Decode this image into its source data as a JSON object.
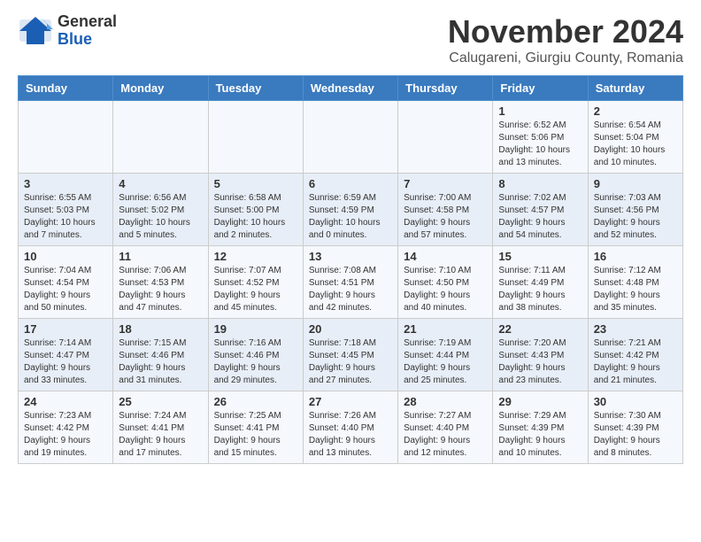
{
  "header": {
    "logo_line1": "General",
    "logo_line2": "Blue",
    "month": "November 2024",
    "location": "Calugareni, Giurgiu County, Romania"
  },
  "weekdays": [
    "Sunday",
    "Monday",
    "Tuesday",
    "Wednesday",
    "Thursday",
    "Friday",
    "Saturday"
  ],
  "weeks": [
    [
      {
        "day": "",
        "info": ""
      },
      {
        "day": "",
        "info": ""
      },
      {
        "day": "",
        "info": ""
      },
      {
        "day": "",
        "info": ""
      },
      {
        "day": "",
        "info": ""
      },
      {
        "day": "1",
        "info": "Sunrise: 6:52 AM\nSunset: 5:06 PM\nDaylight: 10 hours and 13 minutes."
      },
      {
        "day": "2",
        "info": "Sunrise: 6:54 AM\nSunset: 5:04 PM\nDaylight: 10 hours and 10 minutes."
      }
    ],
    [
      {
        "day": "3",
        "info": "Sunrise: 6:55 AM\nSunset: 5:03 PM\nDaylight: 10 hours and 7 minutes."
      },
      {
        "day": "4",
        "info": "Sunrise: 6:56 AM\nSunset: 5:02 PM\nDaylight: 10 hours and 5 minutes."
      },
      {
        "day": "5",
        "info": "Sunrise: 6:58 AM\nSunset: 5:00 PM\nDaylight: 10 hours and 2 minutes."
      },
      {
        "day": "6",
        "info": "Sunrise: 6:59 AM\nSunset: 4:59 PM\nDaylight: 10 hours and 0 minutes."
      },
      {
        "day": "7",
        "info": "Sunrise: 7:00 AM\nSunset: 4:58 PM\nDaylight: 9 hours and 57 minutes."
      },
      {
        "day": "8",
        "info": "Sunrise: 7:02 AM\nSunset: 4:57 PM\nDaylight: 9 hours and 54 minutes."
      },
      {
        "day": "9",
        "info": "Sunrise: 7:03 AM\nSunset: 4:56 PM\nDaylight: 9 hours and 52 minutes."
      }
    ],
    [
      {
        "day": "10",
        "info": "Sunrise: 7:04 AM\nSunset: 4:54 PM\nDaylight: 9 hours and 50 minutes."
      },
      {
        "day": "11",
        "info": "Sunrise: 7:06 AM\nSunset: 4:53 PM\nDaylight: 9 hours and 47 minutes."
      },
      {
        "day": "12",
        "info": "Sunrise: 7:07 AM\nSunset: 4:52 PM\nDaylight: 9 hours and 45 minutes."
      },
      {
        "day": "13",
        "info": "Sunrise: 7:08 AM\nSunset: 4:51 PM\nDaylight: 9 hours and 42 minutes."
      },
      {
        "day": "14",
        "info": "Sunrise: 7:10 AM\nSunset: 4:50 PM\nDaylight: 9 hours and 40 minutes."
      },
      {
        "day": "15",
        "info": "Sunrise: 7:11 AM\nSunset: 4:49 PM\nDaylight: 9 hours and 38 minutes."
      },
      {
        "day": "16",
        "info": "Sunrise: 7:12 AM\nSunset: 4:48 PM\nDaylight: 9 hours and 35 minutes."
      }
    ],
    [
      {
        "day": "17",
        "info": "Sunrise: 7:14 AM\nSunset: 4:47 PM\nDaylight: 9 hours and 33 minutes."
      },
      {
        "day": "18",
        "info": "Sunrise: 7:15 AM\nSunset: 4:46 PM\nDaylight: 9 hours and 31 minutes."
      },
      {
        "day": "19",
        "info": "Sunrise: 7:16 AM\nSunset: 4:46 PM\nDaylight: 9 hours and 29 minutes."
      },
      {
        "day": "20",
        "info": "Sunrise: 7:18 AM\nSunset: 4:45 PM\nDaylight: 9 hours and 27 minutes."
      },
      {
        "day": "21",
        "info": "Sunrise: 7:19 AM\nSunset: 4:44 PM\nDaylight: 9 hours and 25 minutes."
      },
      {
        "day": "22",
        "info": "Sunrise: 7:20 AM\nSunset: 4:43 PM\nDaylight: 9 hours and 23 minutes."
      },
      {
        "day": "23",
        "info": "Sunrise: 7:21 AM\nSunset: 4:42 PM\nDaylight: 9 hours and 21 minutes."
      }
    ],
    [
      {
        "day": "24",
        "info": "Sunrise: 7:23 AM\nSunset: 4:42 PM\nDaylight: 9 hours and 19 minutes."
      },
      {
        "day": "25",
        "info": "Sunrise: 7:24 AM\nSunset: 4:41 PM\nDaylight: 9 hours and 17 minutes."
      },
      {
        "day": "26",
        "info": "Sunrise: 7:25 AM\nSunset: 4:41 PM\nDaylight: 9 hours and 15 minutes."
      },
      {
        "day": "27",
        "info": "Sunrise: 7:26 AM\nSunset: 4:40 PM\nDaylight: 9 hours and 13 minutes."
      },
      {
        "day": "28",
        "info": "Sunrise: 7:27 AM\nSunset: 4:40 PM\nDaylight: 9 hours and 12 minutes."
      },
      {
        "day": "29",
        "info": "Sunrise: 7:29 AM\nSunset: 4:39 PM\nDaylight: 9 hours and 10 minutes."
      },
      {
        "day": "30",
        "info": "Sunrise: 7:30 AM\nSunset: 4:39 PM\nDaylight: 9 hours and 8 minutes."
      }
    ]
  ]
}
